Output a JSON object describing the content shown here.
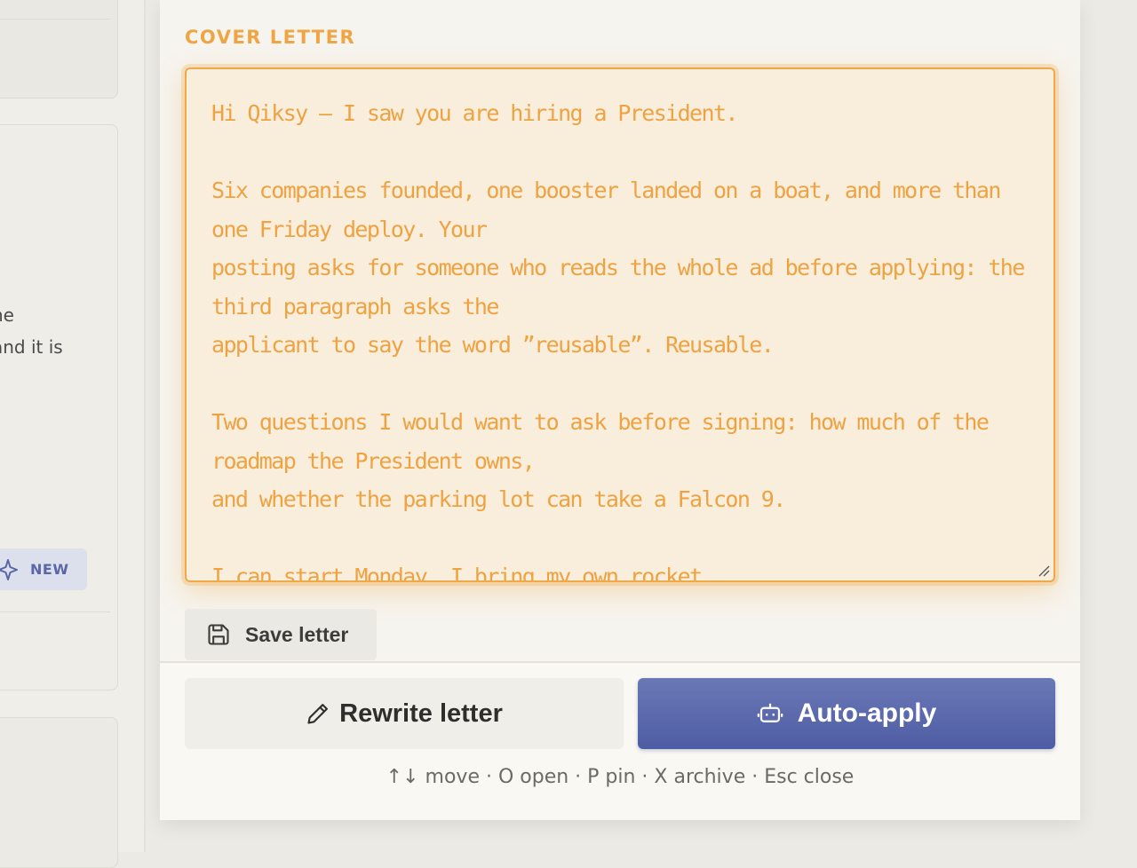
{
  "background": {
    "text_line_1": "he",
    "text_line_2": "and it is",
    "new_badge": "NEW"
  },
  "panel": {
    "section_title": "COVER LETTER",
    "letter_text": "Hi Qiksy — I saw you are hiring a President.\n\nSix companies founded, one booster landed on a boat, and more than one Friday deploy. Your\nposting asks for someone who reads the whole ad before applying: the third paragraph asks the\napplicant to say the word ”reusable”. Reusable.\n\nTwo questions I would want to ask before signing: how much of the roadmap the President owns,\nand whether the parking lot can take a Falcon 9.\n\nI can start Monday. I bring my own rocket.",
    "save_label": "Save letter",
    "rewrite_label": "Rewrite letter",
    "apply_label": "Auto-apply",
    "shortcuts": "↑↓ move · O open · P pin · X archive · Esc close"
  },
  "colors": {
    "accent_orange": "#efa544",
    "primary_blue": "#5a67ab",
    "letter_bg": "#f9eddc"
  }
}
